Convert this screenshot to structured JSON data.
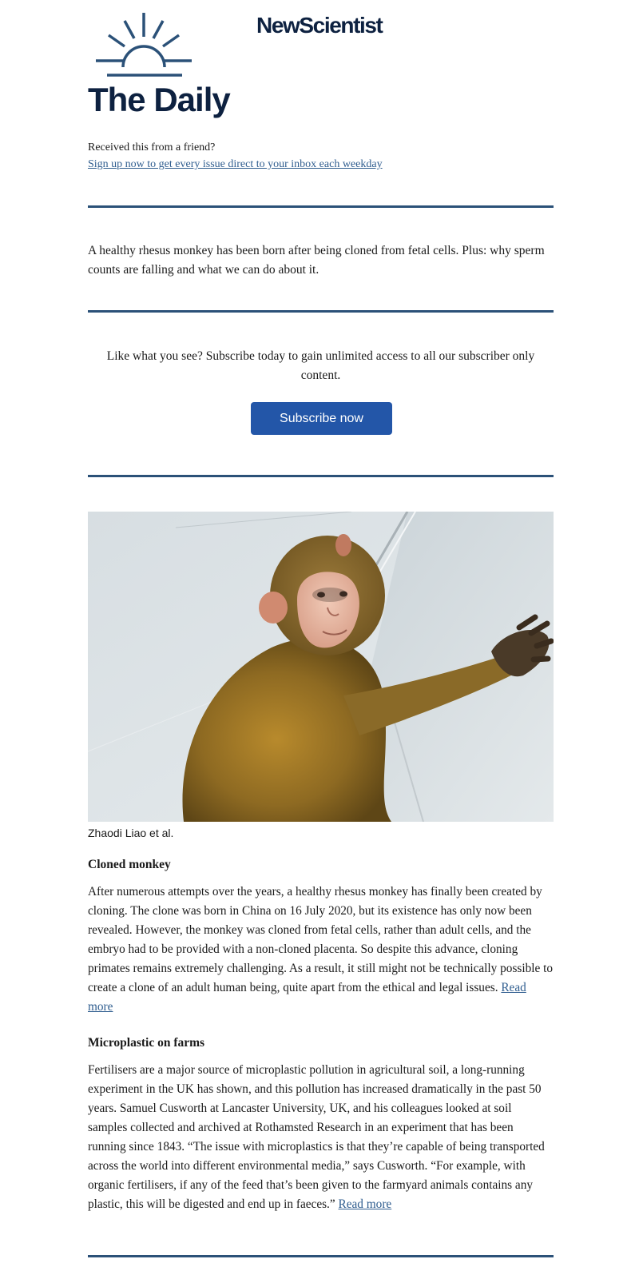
{
  "header": {
    "brand": "NewScientist",
    "title": "The Daily",
    "friend_text": "Received this from a friend?",
    "signup_link": "Sign up now to get every issue direct to your inbox each weekday"
  },
  "intro": "A healthy rhesus monkey has been born after being cloned from fetal cells. Plus: why sperm counts are falling and what we can do about it.",
  "promo": {
    "text": "Like what you see? Subscribe today to gain unlimited access to all our subscriber only content.",
    "button_label": "Subscribe now"
  },
  "image": {
    "subject": "rhesus-monkey-photo",
    "caption": "Zhaodi Liao et al."
  },
  "articles": [
    {
      "heading": "Cloned monkey",
      "body": "After numerous attempts over the years, a healthy rhesus monkey has finally been created by cloning. The clone was born in China on 16 July 2020, but its existence has only now been revealed. However, the monkey was cloned from fetal cells, rather than adult cells, and the embryo had to be provided with a non-cloned placenta. So despite this advance, cloning primates remains extremely challenging. As a result, it still might not be technically possible to create a clone of an adult human being, quite apart from the ethical and legal issues.",
      "read_more": "Read more"
    },
    {
      "heading": "Microplastic on farms",
      "body": "Fertilisers are a major source of microplastic pollution in agricultural soil, a long-running experiment in the UK has shown, and this pollution has increased dramatically in the past 50 years. Samuel Cusworth at Lancaster University, UK, and his colleagues looked at soil samples collected and archived at Rothamsted Research in an experiment that has been running since 1843. “The issue with microplastics is that they’re capable of being transported across the world into different environmental media,” says Cusworth. “For example, with organic fertilisers, if any of the feed that’s been given to the farmyard animals contains any plastic, this will be digested and end up in faeces.”",
      "read_more": "Read more"
    }
  ],
  "colors": {
    "navy": "#0d2140",
    "divider": "#2b5178",
    "link": "#2f5d8f",
    "button": "#2356a8"
  }
}
